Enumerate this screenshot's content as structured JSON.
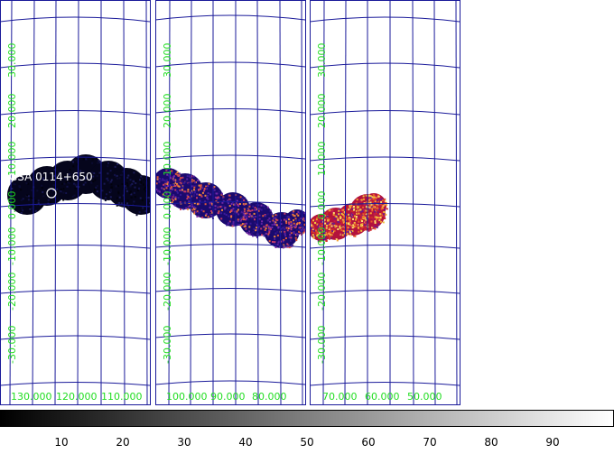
{
  "source_label": "GSA 0114+650",
  "panels": [
    {
      "lat_labels": [
        "30.000",
        "20.000",
        "10.000",
        "0.000",
        "-10.000",
        "-20.000",
        "-30.000"
      ],
      "lon_labels": [
        "130.000",
        "120.000",
        "110.000"
      ]
    },
    {
      "lat_labels": [
        "30.000",
        "20.000",
        "10.000",
        "0.000",
        "-10.000",
        "-20.000",
        "-30.000"
      ],
      "lon_labels": [
        "100.000",
        "90.000",
        "80.000"
      ]
    },
    {
      "lat_labels": [
        "30.000",
        "20.000",
        "10.000",
        "0.000",
        "-10.000",
        "-20.000",
        "-30.000"
      ],
      "lon_labels": [
        "70.000",
        "60.000",
        "50.000"
      ]
    }
  ],
  "colorbar": {
    "ticks": [
      "10",
      "20",
      "30",
      "40",
      "50",
      "60",
      "70",
      "80",
      "90"
    ],
    "min": 0,
    "max": 100
  },
  "colors": {
    "grid": "#1a1a9a",
    "label": "#22dd22",
    "background": "#ffffff"
  }
}
